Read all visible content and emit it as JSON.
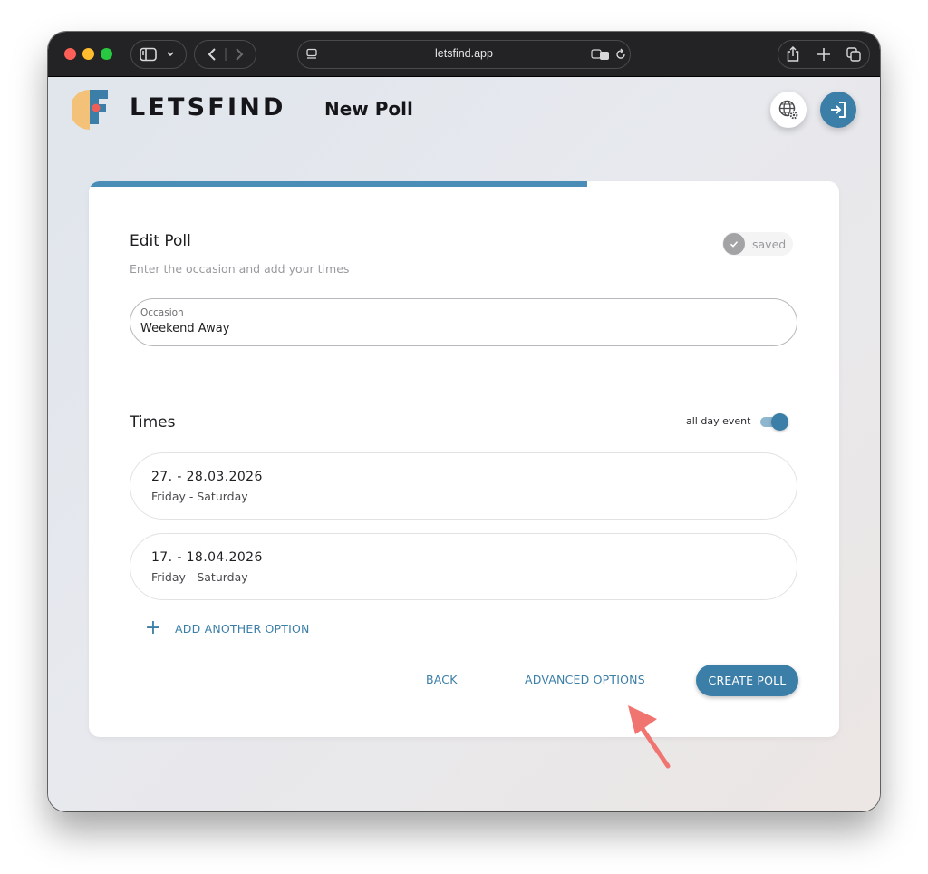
{
  "browser": {
    "url": "letsfind.app"
  },
  "app": {
    "brand": "LETSFIND",
    "page_title": "New Poll"
  },
  "progress": {
    "fraction": 0.664
  },
  "card": {
    "title": "Edit Poll",
    "subtitle": "Enter the occasion and add your times",
    "saved_label": "saved",
    "occasion": {
      "label": "Occasion",
      "value": "Weekend Away"
    },
    "times": {
      "title": "Times",
      "toggle_label": "all day event",
      "toggle_on": true,
      "items": [
        {
          "date": "27. - 28.03.2026",
          "days": "Friday - Saturday"
        },
        {
          "date": "17. - 18.04.2026",
          "days": "Friday - Saturday"
        }
      ],
      "add_label": "ADD ANOTHER OPTION"
    },
    "actions": {
      "back": "BACK",
      "advanced": "ADVANCED OPTIONS",
      "create": "CREATE POLL"
    }
  },
  "colors": {
    "accent": "#3b7ea8",
    "progress": "#4a8db7",
    "annotation_arrow": "#f07470"
  },
  "icons": {
    "language": "globe-gear-icon",
    "login": "login-arrow-icon",
    "saved": "check-icon",
    "add": "plus-icon"
  }
}
